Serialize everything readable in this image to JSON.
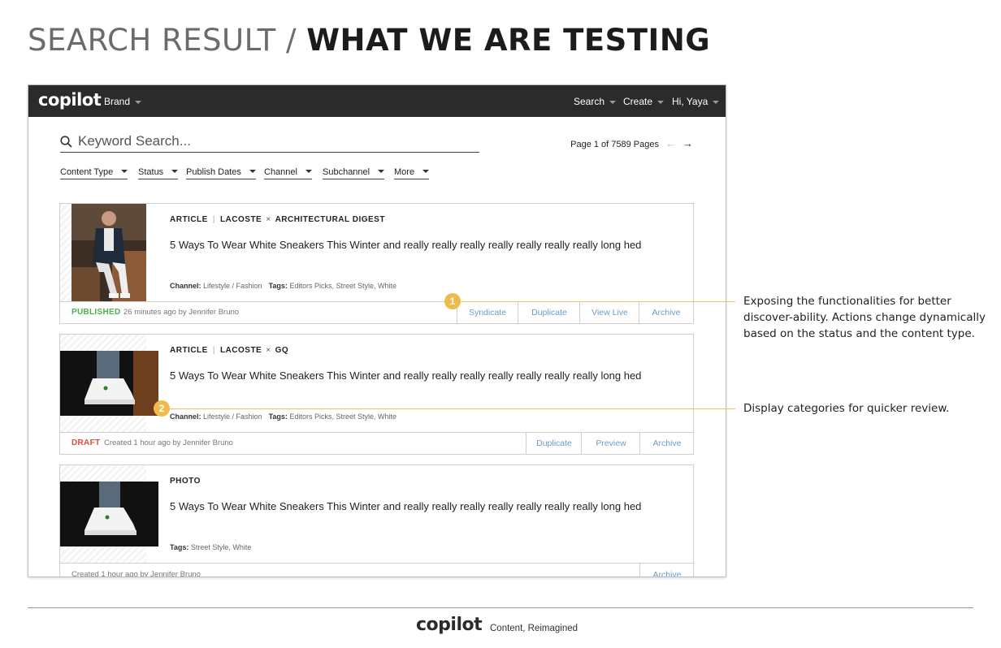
{
  "header": {
    "title_prefix": "SEARCH RESULT / ",
    "title_main": "WHAT WE ARE TESTING"
  },
  "app": {
    "logo": "copilot",
    "nav": {
      "brand": "Brand",
      "search": "Search",
      "create": "Create",
      "user": "Hi, Yaya"
    },
    "search": {
      "placeholder": "Keyword Search...",
      "value": ""
    },
    "pager": {
      "text": "Page 1 of 7589 Pages",
      "prev_arrow": "←",
      "next_arrow": "→"
    },
    "filters": [
      "Content Type",
      "Status",
      "Publish Dates",
      "Channel",
      "Subchannel",
      "More"
    ],
    "results": [
      {
        "type": "ARTICLE",
        "brand": "LACOSTE",
        "cross": "×",
        "partner": "ARCHITECTURAL DIGEST",
        "hed": "5 Ways To Wear White Sneakers This Winter and really really really really really really really long hed",
        "channel_label": "Channel:",
        "channel": "Lifestyle / Fashion",
        "tags_label": "Tags:",
        "tags": "Editors Picks, Street Style, White",
        "status": "PUBLISHED",
        "status_color": "#4caf50",
        "byline": "26 minutes ago by Jennifer Bruno",
        "actions": [
          "Syndicate",
          "Duplicate",
          "View Live",
          "Archive"
        ]
      },
      {
        "type": "ARTICLE",
        "brand": "LACOSTE",
        "cross": "×",
        "partner": "GQ",
        "hed": "5 Ways To Wear White Sneakers This Winter and really really really really really really really long hed",
        "channel_label": "Channel:",
        "channel": "Lifestyle / Fashion",
        "tags_label": "Tags:",
        "tags": "Editors Picks, Street Style, White",
        "status": "DRAFT",
        "status_color": "#e04b3c",
        "byline": "Created 1 hour ago by Jennifer Bruno",
        "actions": [
          "Duplicate",
          "Preview",
          "Archive"
        ]
      },
      {
        "type": "PHOTO",
        "hed": "5 Ways To Wear White Sneakers This Winter and really really really really really really really long hed",
        "tags_label": "Tags:",
        "tags": "Street Style, White",
        "byline": "Created 1 hour ago by Jennifer Bruno",
        "actions": [
          "Archive"
        ]
      }
    ]
  },
  "annotations": [
    {
      "number": "1",
      "text": "Exposing the functionalities for better discover-ability. Actions change dynamically based on the status and the content type."
    },
    {
      "number": "2",
      "text": "Display categories for quicker review."
    }
  ],
  "footer": {
    "logo": "copilot",
    "tagline": "Content, Reimagined"
  },
  "colors": {
    "topbar": "#2b2b2b",
    "action_link": "#6a9cc9",
    "annotation": "#f0bb4e",
    "published": "#4caf50",
    "draft": "#e04b3c"
  }
}
